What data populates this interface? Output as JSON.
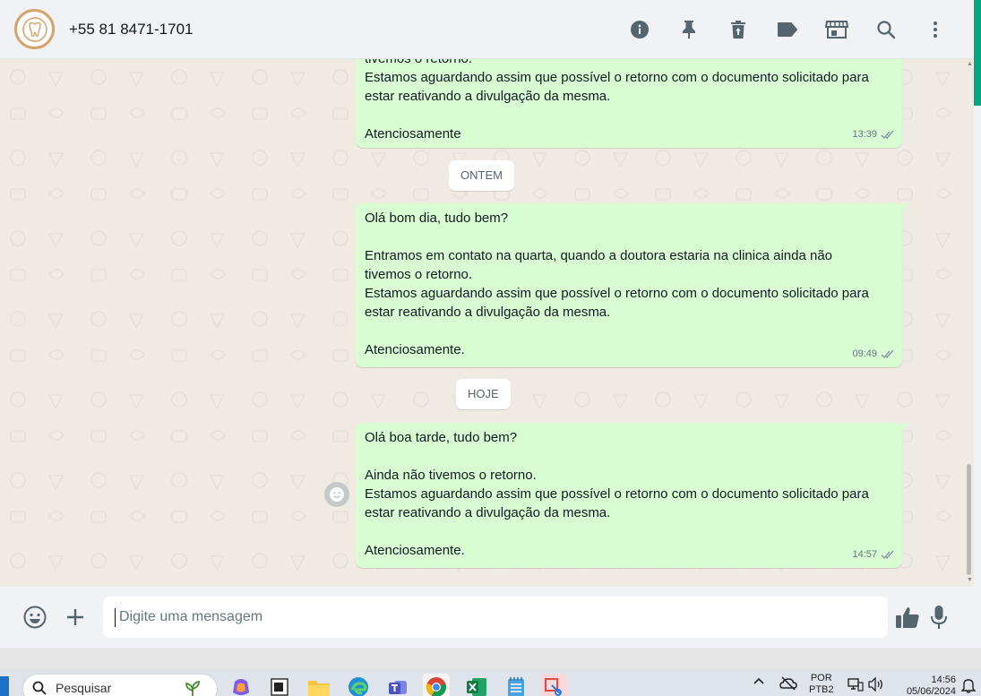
{
  "header": {
    "contact_name": "+55 81 8471-1701",
    "icons": [
      "info-icon",
      "pin-icon",
      "delete-icon",
      "label-icon",
      "store-icon",
      "search-icon",
      "menu-icon"
    ]
  },
  "messages": [
    {
      "lines": [
        "tivemos o retorno.",
        "Estamos aguardando assim que possível o retorno com o documento solicitado para",
        "estar reativando a divulgação da mesma.",
        "",
        "Atenciosamente"
      ],
      "time": "13:39"
    },
    {
      "lines": [
        "Olá bom dia, tudo bem?",
        "",
        "Entramos em contato na quarta, quando a doutora estaria na clinica ainda não",
        "tivemos o retorno.",
        "Estamos aguardando assim que possível o retorno com o documento solicitado para",
        "estar reativando a divulgação da mesma.",
        "",
        "Atenciosamente."
      ],
      "time": "09:49"
    },
    {
      "lines": [
        "Olá boa tarde, tudo bem?",
        "",
        "Ainda não tivemos o retorno.",
        "Estamos aguardando assim que possível o retorno com o documento solicitado para",
        "estar reativando a divulgação da mesma.",
        "",
        "Atenciosamente."
      ],
      "time": "14:57"
    }
  ],
  "dates": {
    "yesterday": "ONTEM",
    "today": "HOJE"
  },
  "composer": {
    "placeholder": "Digite uma mensagem"
  },
  "taskbar": {
    "search_label": "Pesquisar",
    "lang_line1": "POR",
    "lang_line2": "PTB2",
    "time": "14:56",
    "date": "05/06/2024"
  },
  "colors": {
    "bubble_out": "#d9fdd3",
    "chat_bg": "#efeae2",
    "panel_bg": "#f0f2f5",
    "accent": "#00a884",
    "read_ticks": "#8696a0"
  }
}
